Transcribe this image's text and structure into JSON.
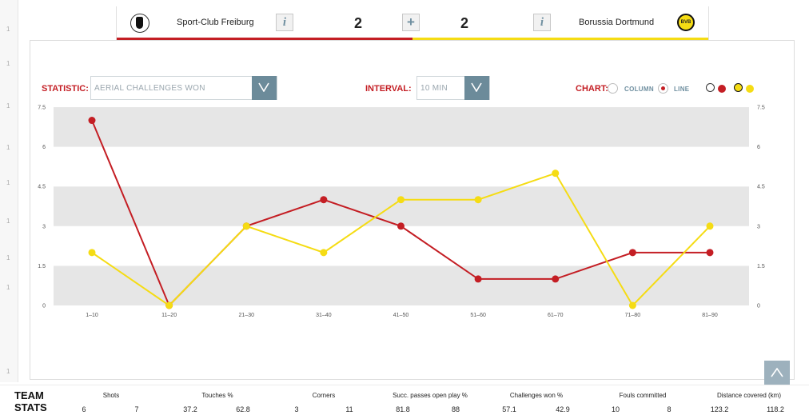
{
  "header": {
    "home_team": "Sport-Club Freiburg",
    "away_team": "Borussia Dortmund",
    "home_score": "2",
    "away_score": "2",
    "info_icon": "i",
    "plus_icon": "+",
    "home_color": "#c41e24",
    "away_color": "#f5dc14"
  },
  "controls": {
    "statistic_label": "STATISTIC:",
    "statistic_value": "AERIAL CHALLENGES WON",
    "interval_label": "INTERVAL:",
    "interval_value": "10 MIN",
    "chart_label": "CHART:",
    "chart_options": [
      "COLUMN",
      "LINE"
    ],
    "chart_selected": "LINE"
  },
  "chart_data": {
    "type": "line",
    "categories": [
      "1–10",
      "11–20",
      "21–30",
      "31–40",
      "41–50",
      "51–60",
      "61–70",
      "71–80",
      "81–90"
    ],
    "series": [
      {
        "values": [
          7,
          0,
          3,
          4,
          3,
          1,
          1,
          2,
          2
        ],
        "color": "#c41e24"
      },
      {
        "values": [
          2,
          0,
          3,
          2,
          4,
          4,
          5,
          0,
          3
        ],
        "color": "#f5dc14"
      }
    ],
    "ylim": [
      0,
      7.5
    ],
    "yticks": [
      "0",
      "1.5",
      "3",
      "4.5",
      "6",
      "7.5"
    ],
    "grid": "alternating bands",
    "title": "",
    "xlabel": "",
    "ylabel": ""
  },
  "team_stats": {
    "title_line1": "TEAM",
    "title_line2": "STATS",
    "columns": [
      {
        "label": "Shots",
        "home": "6",
        "away": "7"
      },
      {
        "label": "Touches %",
        "home": "37.2",
        "away": "62.8"
      },
      {
        "label": "Corners",
        "home": "3",
        "away": "11"
      },
      {
        "label": "Succ. passes open play %",
        "home": "81.8",
        "away": "88"
      },
      {
        "label": "Challenges won %",
        "home": "57.1",
        "away": "42.9"
      },
      {
        "label": "Fouls committed",
        "home": "10",
        "away": "8"
      },
      {
        "label": "Distance covered (km)",
        "home": "123.2",
        "away": "118.2"
      }
    ]
  },
  "icons": {
    "scroll_up": "chevron-up-icon",
    "dropdown": "chevron-down-icon"
  }
}
